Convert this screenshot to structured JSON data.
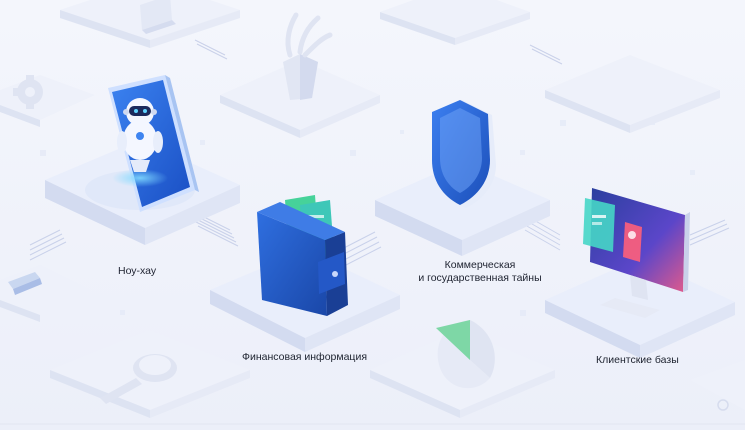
{
  "labels": {
    "knowhow": "Ноу-хау",
    "commercial_line1": "Коммерческая",
    "commercial_line2": "и государственная тайны",
    "financial": "Финансовая информация",
    "clients": "Клиентские базы"
  },
  "colors": {
    "background": "#f2f4fb",
    "platform_top": "#eef1fa",
    "platform_side": "#dfe4f3",
    "accent_blue": "#2f6fe0",
    "deep_blue": "#1b4fb8",
    "teal": "#3ec7b8",
    "green": "#46d29a",
    "text": "#1e2330"
  },
  "icons": [
    "gear-icon",
    "robot-phone-icon",
    "plant-vase-icon",
    "shield-icon",
    "wallet-icon",
    "monitor-icon",
    "magnifier-icon",
    "pie-chart-icon",
    "pen-icon"
  ]
}
